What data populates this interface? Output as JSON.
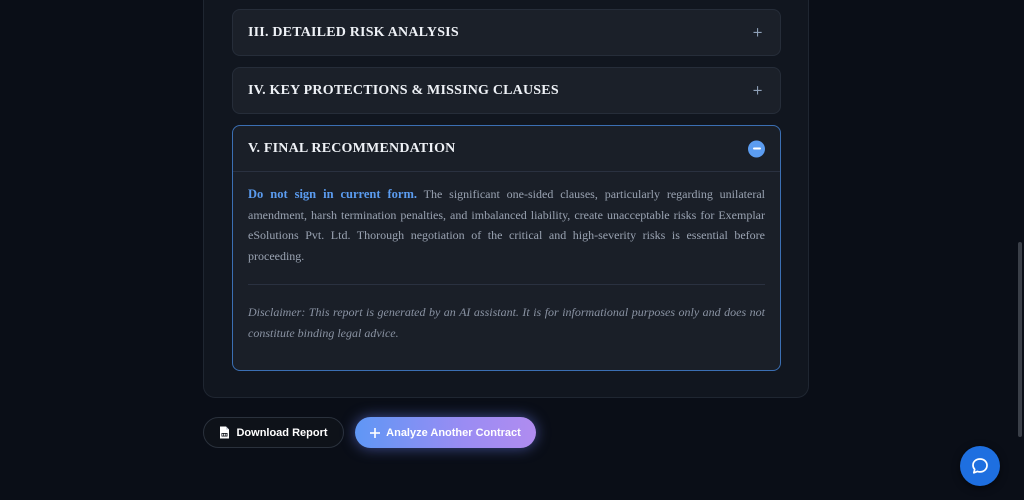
{
  "sections": [
    {
      "title": "III. DETAILED RISK ANALYSIS",
      "state": "collapsed"
    },
    {
      "title": "IV. KEY PROTECTIONS & MISSING CLAUSES",
      "state": "collapsed"
    },
    {
      "title": "V. FINAL RECOMMENDATION",
      "state": "expanded"
    }
  ],
  "recommendation": {
    "lead": "Do not sign in current form.",
    "body": "The significant one-sided clauses, particularly regarding unilateral amendment, harsh termination penalties, and imbalanced liability, create unacceptable risks for Exemplar eSolutions Pvt. Ltd. Thorough negotiation of the critical and high-severity risks is essential before proceeding.",
    "disclaimer": "Disclaimer: This report is generated by an AI assistant. It is for informational purposes only and does not constitute binding legal advice."
  },
  "actions": {
    "download_label": "Download Report",
    "analyze_label": "Analyze Another Contract"
  },
  "icons": {
    "expand": "plus-icon",
    "collapse": "minus-icon",
    "download": "pdf-file-icon",
    "analyze": "plus-icon",
    "chat": "chat-bubble-icon"
  },
  "colors": {
    "background": "#0a0e17",
    "accent": "#5b9cf0",
    "gradient_start": "#5f97f5",
    "gradient_end": "#b08cf0",
    "chat_button": "#1e6fe0"
  }
}
